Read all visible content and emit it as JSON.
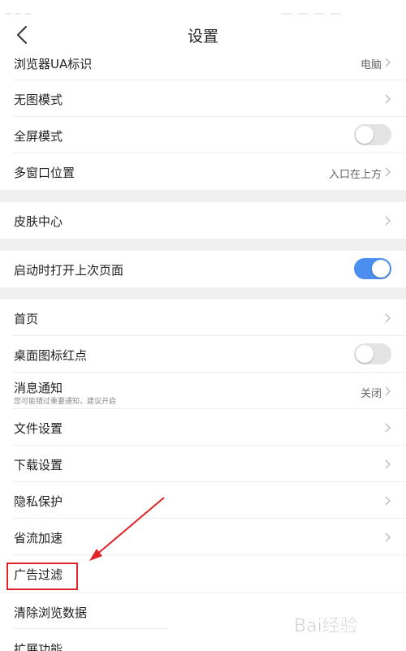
{
  "header": {
    "title": "设置"
  },
  "rows": [
    {
      "label": "浏览器UA标识",
      "value": "电脑"
    },
    {
      "label": "无图模式"
    },
    {
      "label": "全屏模式",
      "toggle": false
    },
    {
      "label": "多窗口位置",
      "value": "入口在上方"
    },
    {
      "label": "皮肤中心"
    },
    {
      "label": "启动时打开上次页面",
      "toggle": true
    },
    {
      "label": "首页"
    },
    {
      "label": "桌面图标红点",
      "toggle": false
    },
    {
      "label": "消息通知",
      "sub": "您可能错过重要通知，建议开启",
      "value": "关闭"
    },
    {
      "label": "文件设置"
    },
    {
      "label": "下载设置"
    },
    {
      "label": "隐私保护"
    },
    {
      "label": "省流加速"
    },
    {
      "label": "广告过滤"
    },
    {
      "label": "清除浏览数据"
    },
    {
      "label": "扩展功能"
    }
  ],
  "colors": {
    "accent": "#4b8ef0",
    "annotation": "#e0242a",
    "section_gap": "#f0f0f0"
  },
  "watermark": {
    "text": "Bai经验"
  }
}
